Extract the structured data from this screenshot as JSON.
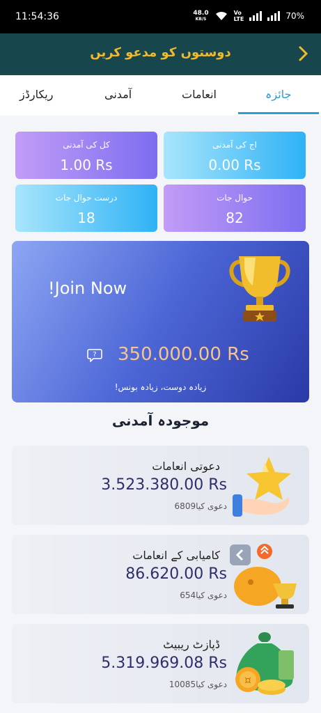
{
  "status_bar": {
    "time": "11:54:36",
    "net_speed": "48.0",
    "net_unit": "KB/S",
    "volte_top": "Vo",
    "volte_bottom": "LTE",
    "battery": "70%"
  },
  "header": {
    "title": "دوستوں کو مدعو کریں"
  },
  "tabs": [
    {
      "label": "جائزہ",
      "active": true
    },
    {
      "label": "انعامات",
      "active": false
    },
    {
      "label": "آمدنی",
      "active": false
    },
    {
      "label": "ریکارڈز",
      "active": false
    }
  ],
  "stats": {
    "total_income": {
      "label": "کل کی آمدنی",
      "value": "1.00 Rs"
    },
    "today_income": {
      "label": "اج کی آمدنی",
      "value": "0.00 Rs"
    },
    "valid_referrals": {
      "label": "درست حوال جات",
      "value": "18"
    },
    "referrals": {
      "label": "حوال جات",
      "value": "82"
    }
  },
  "banner": {
    "join": "!Join Now",
    "amount": "350.000.00 Rs",
    "bonus": "زیادہ دوست، زیادہ بونس!"
  },
  "section_title": "موجودہ آمدنی",
  "rewards": [
    {
      "title": "دعوتی انعامات",
      "amount": "3.523.380.00 Rs",
      "count": "6809دعوی کیا",
      "icon": "star-hand-icon"
    },
    {
      "title": "کامیابی کے انعامات",
      "amount": "86.620.00 Rs",
      "count": "654دعوی کیا",
      "icon": "trophy-piggy-icon"
    },
    {
      "title": "ڈپازٹ ریبیٹ",
      "amount": "5.319.969.08 Rs",
      "count": "10085دعوی کیا",
      "icon": "money-bag-icon"
    }
  ],
  "colors": {
    "header_bg": "#17464c",
    "header_text": "#f1b92d",
    "accent": "#2a9fd8",
    "amount": "#2e2f6b"
  }
}
